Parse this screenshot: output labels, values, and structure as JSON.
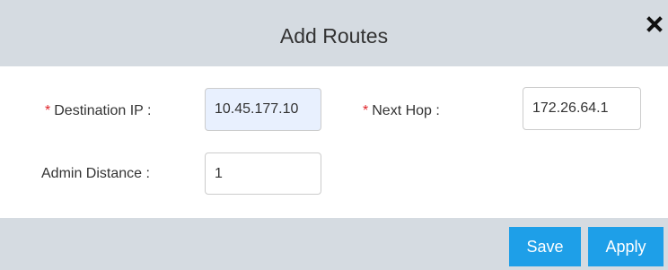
{
  "dialog": {
    "title": "Add Routes",
    "close_icon": "close-icon"
  },
  "form": {
    "destination_ip": {
      "required_mark": "*",
      "label": "Destination IP :",
      "value": "10.45.177.10"
    },
    "next_hop": {
      "required_mark": "*",
      "label": "Next Hop :",
      "value": "172.26.64.1"
    },
    "admin_distance": {
      "label": "Admin Distance :",
      "value": "1"
    }
  },
  "footer": {
    "save_label": "Save",
    "apply_label": "Apply"
  },
  "colors": {
    "header_bg": "#d5dbe1",
    "button_bg": "#1e9fe8",
    "required": "#e0242a",
    "autofill_bg": "#e8f0fe"
  }
}
